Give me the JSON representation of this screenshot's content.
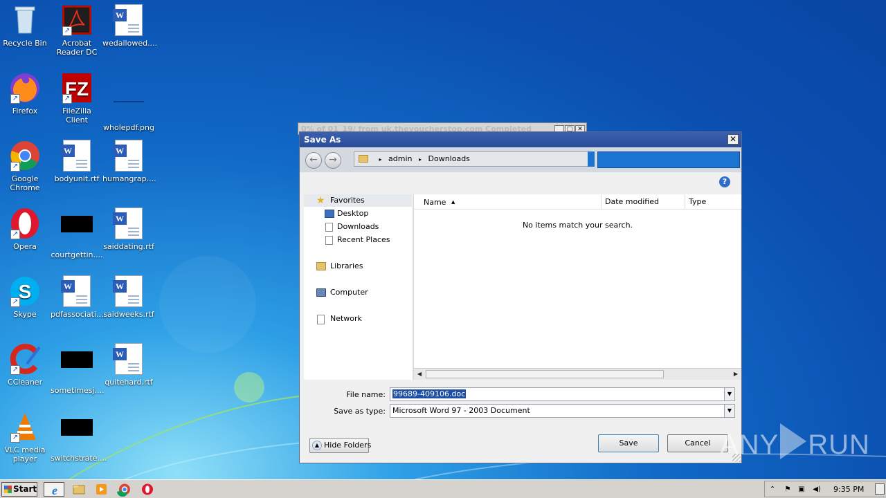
{
  "desktop": {
    "icons": [
      {
        "label": "Recycle Bin",
        "icon": "recycle-bin-icon"
      },
      {
        "label": "Acrobat Reader DC",
        "icon": "acrobat-icon"
      },
      {
        "label": "wedallowed....",
        "icon": "word-doc-icon"
      },
      {
        "label": "Firefox",
        "icon": "firefox-icon"
      },
      {
        "label": "FileZilla Client",
        "icon": "filezilla-icon"
      },
      {
        "label": "wholepdf.png",
        "icon": "image-file-icon"
      },
      {
        "label": "Google Chrome",
        "icon": "chrome-icon"
      },
      {
        "label": "bodyunit.rtf",
        "icon": "word-doc-icon"
      },
      {
        "label": "humangrap....",
        "icon": "word-doc-icon"
      },
      {
        "label": "Opera",
        "icon": "opera-icon"
      },
      {
        "label": "courtgettin....",
        "icon": "black-file-icon"
      },
      {
        "label": "saiddating.rtf",
        "icon": "word-doc-icon"
      },
      {
        "label": "Skype",
        "icon": "skype-icon"
      },
      {
        "label": "pdfassociati....",
        "icon": "word-doc-icon"
      },
      {
        "label": "saidweeks.rtf",
        "icon": "word-doc-icon"
      },
      {
        "label": "CCleaner",
        "icon": "ccleaner-icon"
      },
      {
        "label": "sometimesj....",
        "icon": "black-file-icon"
      },
      {
        "label": "quitehard.rtf",
        "icon": "word-doc-icon"
      },
      {
        "label": "VLC media player",
        "icon": "vlc-icon"
      },
      {
        "label": "switchstrate....",
        "icon": "black-file-icon"
      }
    ]
  },
  "background_window": {
    "title": "0% of 01_19/ from uk.thevoucherstop.com Completed"
  },
  "dialog": {
    "title": "Save As",
    "close_glyph": "✕",
    "breadcrumb": [
      "admin",
      "Downloads"
    ],
    "breadcrumb_sep": "▸",
    "nav_pane": {
      "favorites": "Favorites",
      "favorites_items": [
        "Desktop",
        "Downloads",
        "Recent Places"
      ],
      "libraries": "Libraries",
      "computer": "Computer",
      "network": "Network"
    },
    "columns": {
      "name": "Name",
      "date_modified": "Date modified",
      "type": "Type"
    },
    "empty_message": "No items match your search.",
    "file_name_label": "File name:",
    "file_name_value": "99689-409106.doc",
    "save_as_type_label": "Save as type:",
    "save_as_type_value": "Microsoft Word 97 - 2003 Document",
    "hide_folders_label": "Hide Folders",
    "save_label": "Save",
    "cancel_label": "Cancel",
    "help_glyph": "?"
  },
  "watermark": {
    "left": "ANY",
    "right": "RUN"
  },
  "taskbar": {
    "start_label": "Start",
    "clock": "9:35 PM",
    "pinned": [
      "internet-explorer-icon",
      "explorer-icon",
      "media-player-icon",
      "chrome-icon",
      "opera-icon"
    ]
  },
  "colors": {
    "dialog_title": "#2a4d98",
    "selection": "#1c4fa5",
    "search_box": "#1c74d2"
  }
}
